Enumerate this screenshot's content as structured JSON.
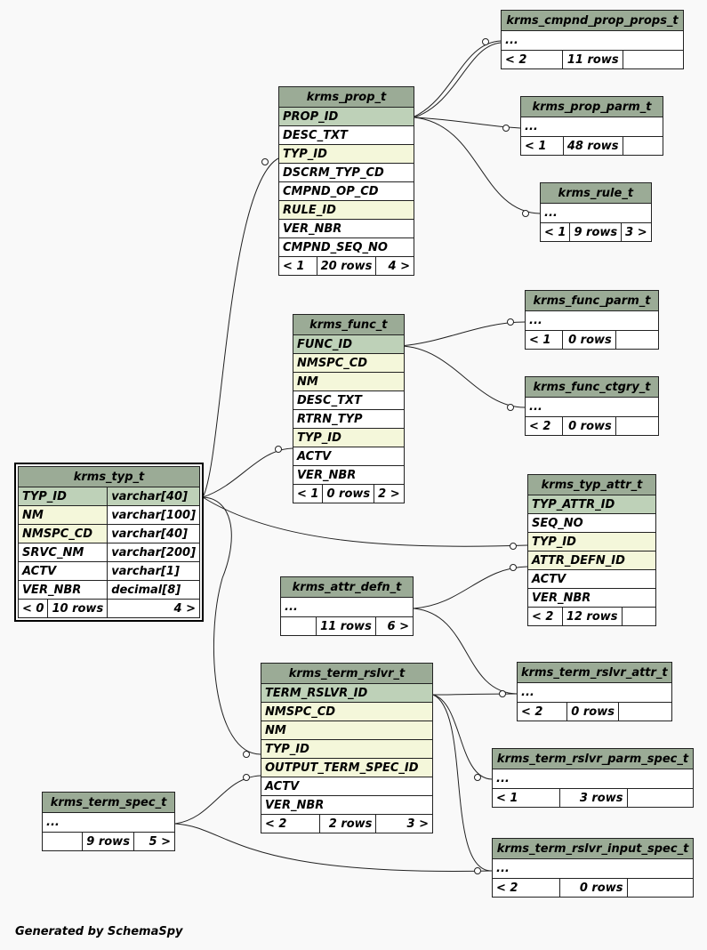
{
  "footer": "Generated by SchemaSpy",
  "tables": {
    "krms_cmpnd_prop_props_t": {
      "name": "krms_cmpnd_prop_props_t",
      "cols": [
        "..."
      ],
      "footer": [
        "< 2",
        "11 rows",
        ""
      ]
    },
    "krms_prop_parm_t": {
      "name": "krms_prop_parm_t",
      "cols": [
        "..."
      ],
      "footer": [
        "< 1",
        "48 rows",
        ""
      ]
    },
    "krms_rule_t": {
      "name": "krms_rule_t",
      "cols": [
        "..."
      ],
      "footer": [
        "< 1",
        "9 rows",
        "3 >"
      ]
    },
    "krms_prop_t": {
      "name": "krms_prop_t",
      "cols": [
        "PROP_ID",
        "DESC_TXT",
        "TYP_ID",
        "DSCRM_TYP_CD",
        "CMPND_OP_CD",
        "RULE_ID",
        "VER_NBR",
        "CMPND_SEQ_NO"
      ],
      "footer": [
        "< 1",
        "20 rows",
        "4 >"
      ]
    },
    "krms_func_parm_t": {
      "name": "krms_func_parm_t",
      "cols": [
        "..."
      ],
      "footer": [
        "< 1",
        "0 rows",
        ""
      ]
    },
    "krms_func_ctgry_t": {
      "name": "krms_func_ctgry_t",
      "cols": [
        "..."
      ],
      "footer": [
        "< 2",
        "0 rows",
        ""
      ]
    },
    "krms_func_t": {
      "name": "krms_func_t",
      "cols": [
        "FUNC_ID",
        "NMSPC_CD",
        "NM",
        "DESC_TXT",
        "RTRN_TYP",
        "TYP_ID",
        "ACTV",
        "VER_NBR"
      ],
      "footer": [
        "< 1",
        "0 rows",
        "2 >"
      ]
    },
    "krms_typ_t": {
      "name": "krms_typ_t",
      "cols": [
        "TYP_ID",
        "NM",
        "NMSPC_CD",
        "SRVC_NM",
        "ACTV",
        "VER_NBR"
      ],
      "types": [
        "varchar[40]",
        "varchar[100]",
        "varchar[40]",
        "varchar[200]",
        "varchar[1]",
        "decimal[8]"
      ],
      "footer": [
        "< 0",
        "10 rows",
        "4 >"
      ]
    },
    "krms_typ_attr_t": {
      "name": "krms_typ_attr_t",
      "cols": [
        "TYP_ATTR_ID",
        "SEQ_NO",
        "TYP_ID",
        "ATTR_DEFN_ID",
        "ACTV",
        "VER_NBR"
      ],
      "footer": [
        "< 2",
        "12 rows",
        ""
      ]
    },
    "krms_attr_defn_t": {
      "name": "krms_attr_defn_t",
      "cols": [
        "..."
      ],
      "footer": [
        "",
        "11 rows",
        "6 >"
      ]
    },
    "krms_term_rslvr_t": {
      "name": "krms_term_rslvr_t",
      "cols": [
        "TERM_RSLVR_ID",
        "NMSPC_CD",
        "NM",
        "TYP_ID",
        "OUTPUT_TERM_SPEC_ID",
        "ACTV",
        "VER_NBR"
      ],
      "footer": [
        "< 2",
        "2 rows",
        "3 >"
      ]
    },
    "krms_term_rslvr_attr_t": {
      "name": "krms_term_rslvr_attr_t",
      "cols": [
        "..."
      ],
      "footer": [
        "< 2",
        "0 rows",
        ""
      ]
    },
    "krms_term_rslvr_parm_spec_t": {
      "name": "krms_term_rslvr_parm_spec_t",
      "cols": [
        "..."
      ],
      "footer": [
        "< 1",
        "3 rows",
        ""
      ]
    },
    "krms_term_spec_t": {
      "name": "krms_term_spec_t",
      "cols": [
        "..."
      ],
      "footer": [
        "",
        "9 rows",
        "5 >"
      ]
    },
    "krms_term_rslvr_input_spec_t": {
      "name": "krms_term_rslvr_input_spec_t",
      "cols": [
        "..."
      ],
      "footer": [
        "< 2",
        "0 rows",
        ""
      ]
    }
  }
}
